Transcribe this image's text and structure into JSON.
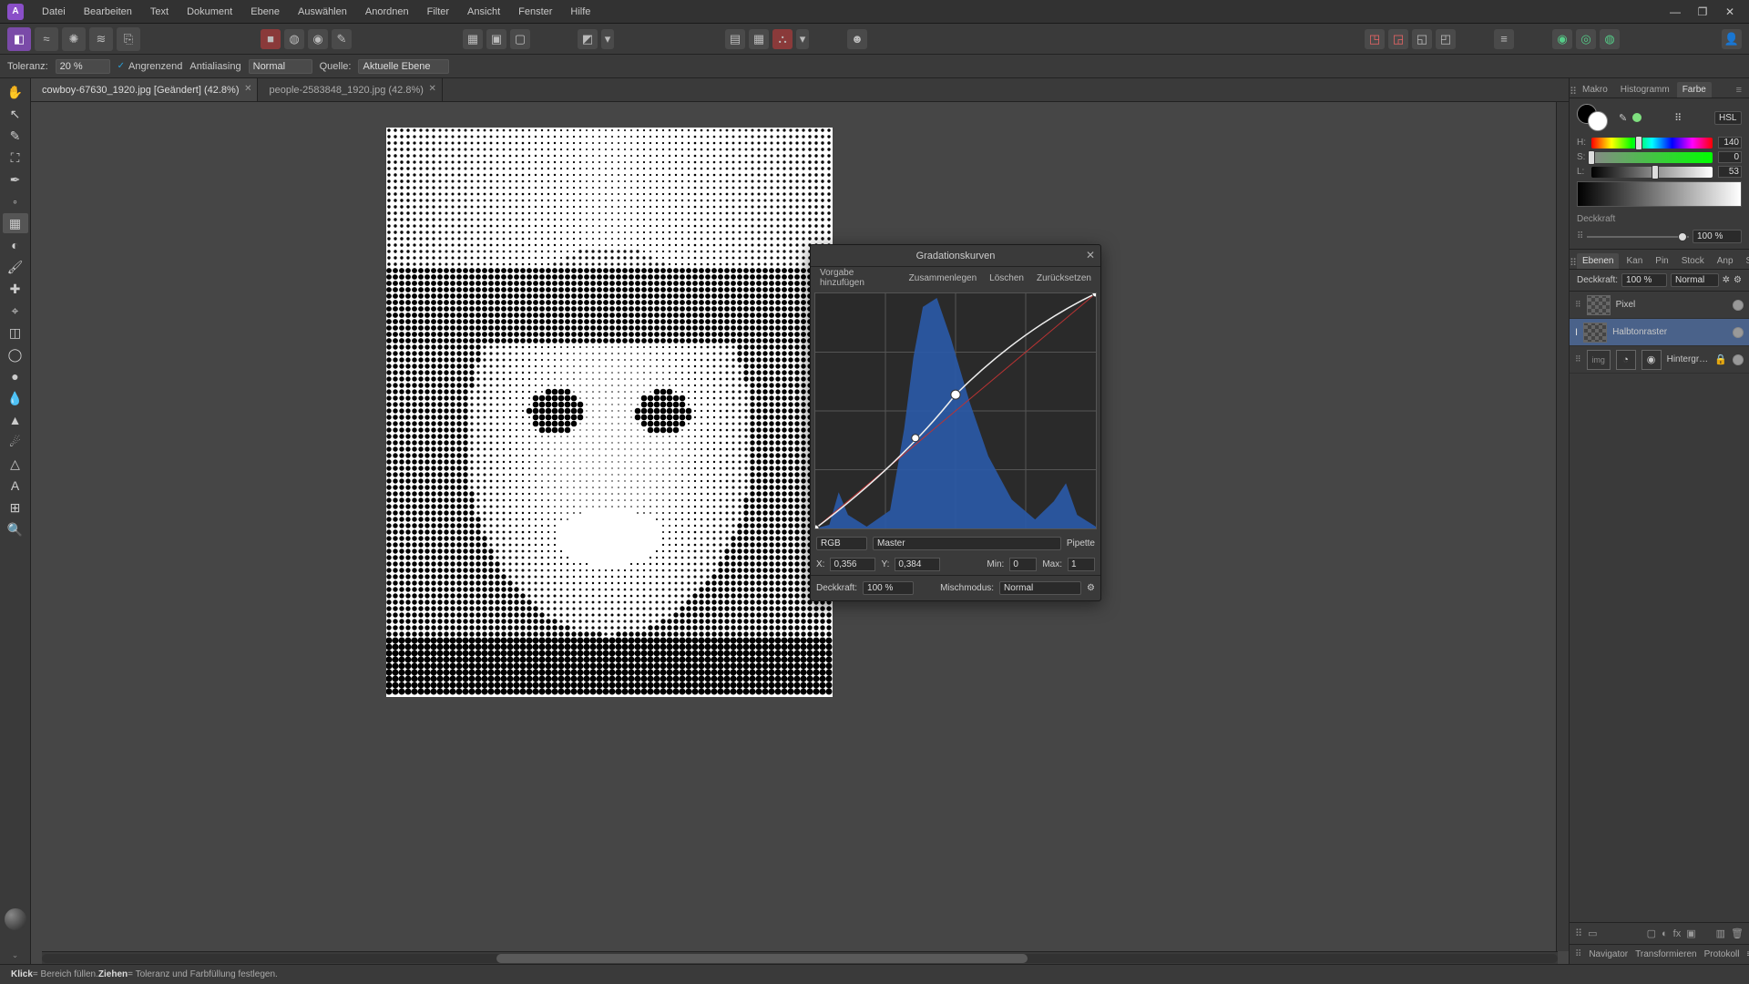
{
  "menu": {
    "items": [
      "Datei",
      "Bearbeiten",
      "Text",
      "Dokument",
      "Ebene",
      "Auswählen",
      "Anordnen",
      "Filter",
      "Ansicht",
      "Fenster",
      "Hilfe"
    ]
  },
  "optbar": {
    "tolerance_label": "Toleranz:",
    "tolerance_value": "20 %",
    "contiguous": "Angrenzend",
    "antialias": "Antialiasing",
    "blendmode": "Normal",
    "source_label": "Quelle:",
    "source_value": "Aktuelle Ebene"
  },
  "documents": [
    {
      "title": "cowboy-67630_1920.jpg [Geändert] (42.8%)",
      "active": true
    },
    {
      "title": "people-2583848_1920.jpg (42.8%)",
      "active": false
    }
  ],
  "right_tabs1": [
    "Makro",
    "Histogramm",
    "Farbe"
  ],
  "right_tabs1_active": "Farbe",
  "color_panel": {
    "model": "HSL",
    "h": "140",
    "s": "0",
    "l": "53",
    "opacity_label": "Deckkraft",
    "opacity_value": "100 %"
  },
  "right_tabs2": [
    "Ebenen",
    "Kan",
    "Pin",
    "Stock",
    "Anp",
    "Stile"
  ],
  "right_tabs2_active": "Ebenen",
  "layers_header": {
    "opacity_label": "Deckkraft:",
    "opacity_value": "100 %",
    "blend": "Normal"
  },
  "layers": [
    {
      "name": "Pixel",
      "sel": false,
      "adj": false,
      "checker": true
    },
    {
      "name": "Halbtonraster",
      "sel": true,
      "adj": false,
      "checker": true,
      "fx": true
    },
    {
      "name": "Hintergru…",
      "sel": false,
      "adj": true,
      "checker": false,
      "locked": true
    }
  ],
  "bottom_tabs": [
    "Navigator",
    "Transformieren",
    "Protokoll"
  ],
  "curves": {
    "title": "Gradationskurven",
    "add_preset": "Vorgabe hinzufügen",
    "merge": "Zusammenlegen",
    "delete": "Löschen",
    "reset": "Zurücksetzen",
    "channel": "RGB",
    "master": "Master",
    "picker": "Pipette",
    "x_label": "X:",
    "x_val": "0,356",
    "y_label": "Y:",
    "y_val": "0,384",
    "min_label": "Min:",
    "min_val": "0",
    "max_label": "Max:",
    "max_val": "1",
    "opacity_label": "Deckkraft:",
    "opacity_value": "100 %",
    "blend_label": "Mischmodus:",
    "blend_value": "Normal"
  },
  "status": {
    "part1": "Klick",
    "part2": " = Bereich füllen. ",
    "part3": "Ziehen",
    "part4": " = Toleranz und Farbfüllung festlegen."
  }
}
